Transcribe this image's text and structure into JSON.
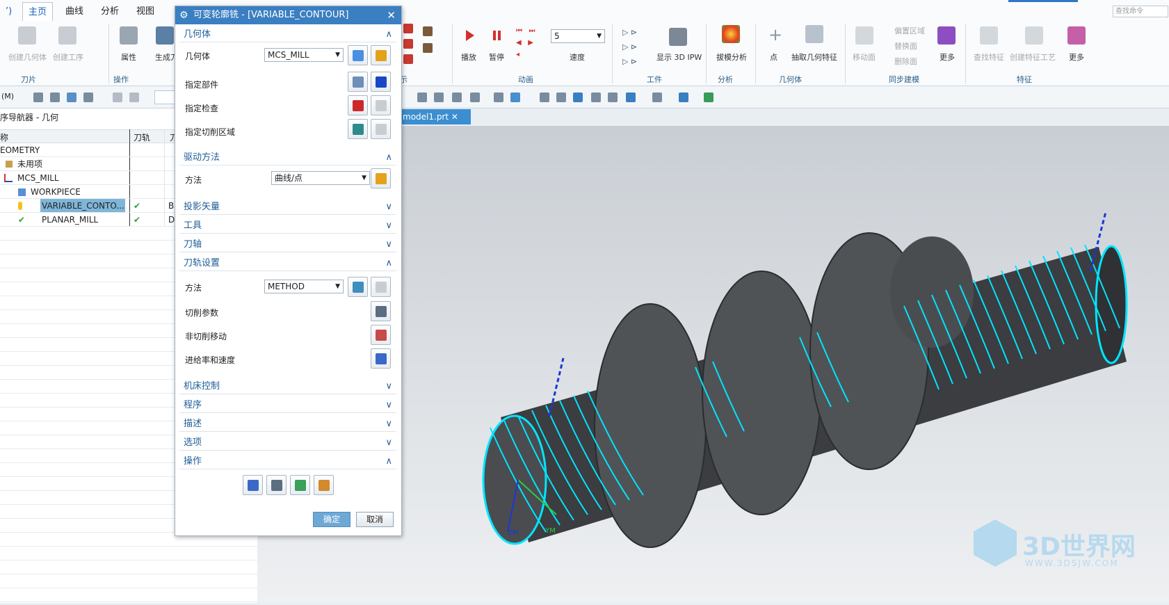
{
  "ribbon": {
    "left_fragment": "’)",
    "tabs": [
      "主页",
      "曲线",
      "分析",
      "视图"
    ],
    "search_placeholder": "查找命令",
    "groups": {
      "blade": "刀片",
      "operation": "操作",
      "display": "示",
      "animation": "动画",
      "workpiece": "工件",
      "analysis": "分析",
      "geometry": "几何体",
      "sync": "同步建模",
      "feature": "特征"
    },
    "buttons": {
      "create_geometry": "创建几何体",
      "create_workpiece": "创建工序",
      "properties": "属性",
      "generate": "生成刀",
      "play": "播放",
      "pause": "暂停",
      "speed_value": "5",
      "speed": "速度",
      "show_3d_ipw": "显示 3D IPW",
      "draft_analysis": "拔模分析",
      "point": "点",
      "extract_geom": "抽取几何特征",
      "move_face": "移动面",
      "offset_region": "偏置区域",
      "replace_face": "替换面",
      "delete_face": "删除面",
      "more": "更多",
      "find_feature": "查找特征",
      "create_feature_process": "创建特征工艺",
      "more2": "更多"
    }
  },
  "toolbar2": {
    "filter_label": "(M)"
  },
  "navigator": {
    "title": "序导航器 - 几何",
    "columns": [
      "称",
      "刀轨",
      "刀"
    ],
    "rows": [
      {
        "name": "EOMETRY",
        "check": "",
        "extra": ""
      },
      {
        "name": "未用项",
        "check": "",
        "extra": ""
      },
      {
        "name": "MCS_MILL",
        "check": "",
        "extra": ""
      },
      {
        "name": "WORKPIECE",
        "check": "",
        "extra": ""
      },
      {
        "name": "VARIABLE_CONTO...",
        "check": "✔",
        "extra": "B"
      },
      {
        "name": "PLANAR_MILL",
        "check": "✔",
        "extra": "D"
      }
    ]
  },
  "viewport": {
    "file_tab": "model1.prt",
    "axes": {
      "zm": "ZM",
      "ym": "YM"
    },
    "watermark": {
      "title": "3D世界网",
      "url": "WWW.3DSJW.COM"
    }
  },
  "dialog": {
    "title": "可变轮廓铣 - [VARIABLE_CONTOUR]",
    "sections": {
      "geometry": "几何体",
      "drive": "驱动方法",
      "projection": "投影矢量",
      "tool": "工具",
      "axis": "刀轴",
      "path_settings": "刀轨设置",
      "machine": "机床控制",
      "program": "程序",
      "description": "描述",
      "options": "选项",
      "actions": "操作"
    },
    "geometry_label": "几何体",
    "geometry_value": "MCS_MILL",
    "specify_part": "指定部件",
    "specify_check": "指定检查",
    "specify_cut_area": "指定切削区域",
    "method_label": "方法",
    "drive_method_value": "曲线/点",
    "path_method_label": "方法",
    "path_method_value": "METHOD",
    "cut_params": "切削参数",
    "non_cut_moves": "非切削移动",
    "feeds_speeds": "进给率和速度",
    "ok": "确定",
    "cancel": "取消"
  }
}
